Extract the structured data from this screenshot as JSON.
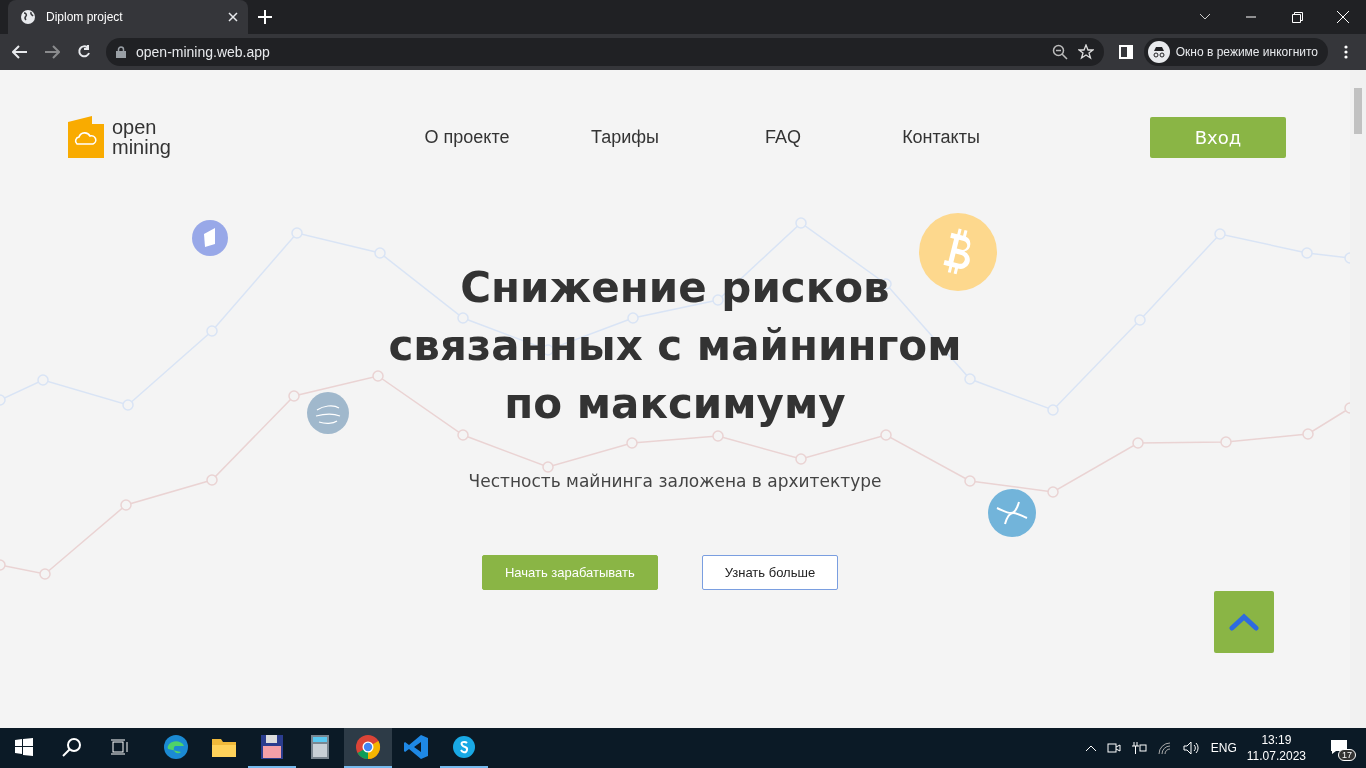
{
  "browser": {
    "tab": {
      "title": "Diplom project",
      "selected": true
    },
    "url": "open-mining.web.app",
    "incognito_label": "Окно в режиме инкогнито"
  },
  "header": {
    "logo": {
      "line_1": "open",
      "line_2": "mining"
    },
    "nav": [
      {
        "label": "О проекте"
      },
      {
        "label": "Тарифы"
      },
      {
        "label": "FAQ"
      },
      {
        "label": "Контакты"
      }
    ],
    "login_button": "Вход"
  },
  "hero": {
    "title_lines": [
      "Снижение рисков",
      "связанных с майнингом",
      "по максимуму"
    ],
    "subtitle": "Честность майнинга заложена в архитектуре",
    "buttons": [
      {
        "label": "Начать зарабатывать",
        "kind": "primary"
      },
      {
        "label": "Узнать больше",
        "kind": "outline"
      }
    ]
  },
  "taskbar": {
    "apps": [
      {
        "kind": "edge",
        "selected": false,
        "running": false
      },
      {
        "kind": "folder",
        "selected": false,
        "running": false
      },
      {
        "kind": "floppy",
        "selected": false,
        "running": true
      },
      {
        "kind": "calculator",
        "selected": false,
        "running": false
      },
      {
        "kind": "chrome",
        "selected": true,
        "running": true
      },
      {
        "kind": "vscode",
        "selected": false,
        "running": false
      },
      {
        "kind": "skype",
        "selected": false,
        "running": true
      }
    ],
    "language": "ENG",
    "time": "13:19",
    "date": "11.07.2023",
    "notifications": "17"
  }
}
